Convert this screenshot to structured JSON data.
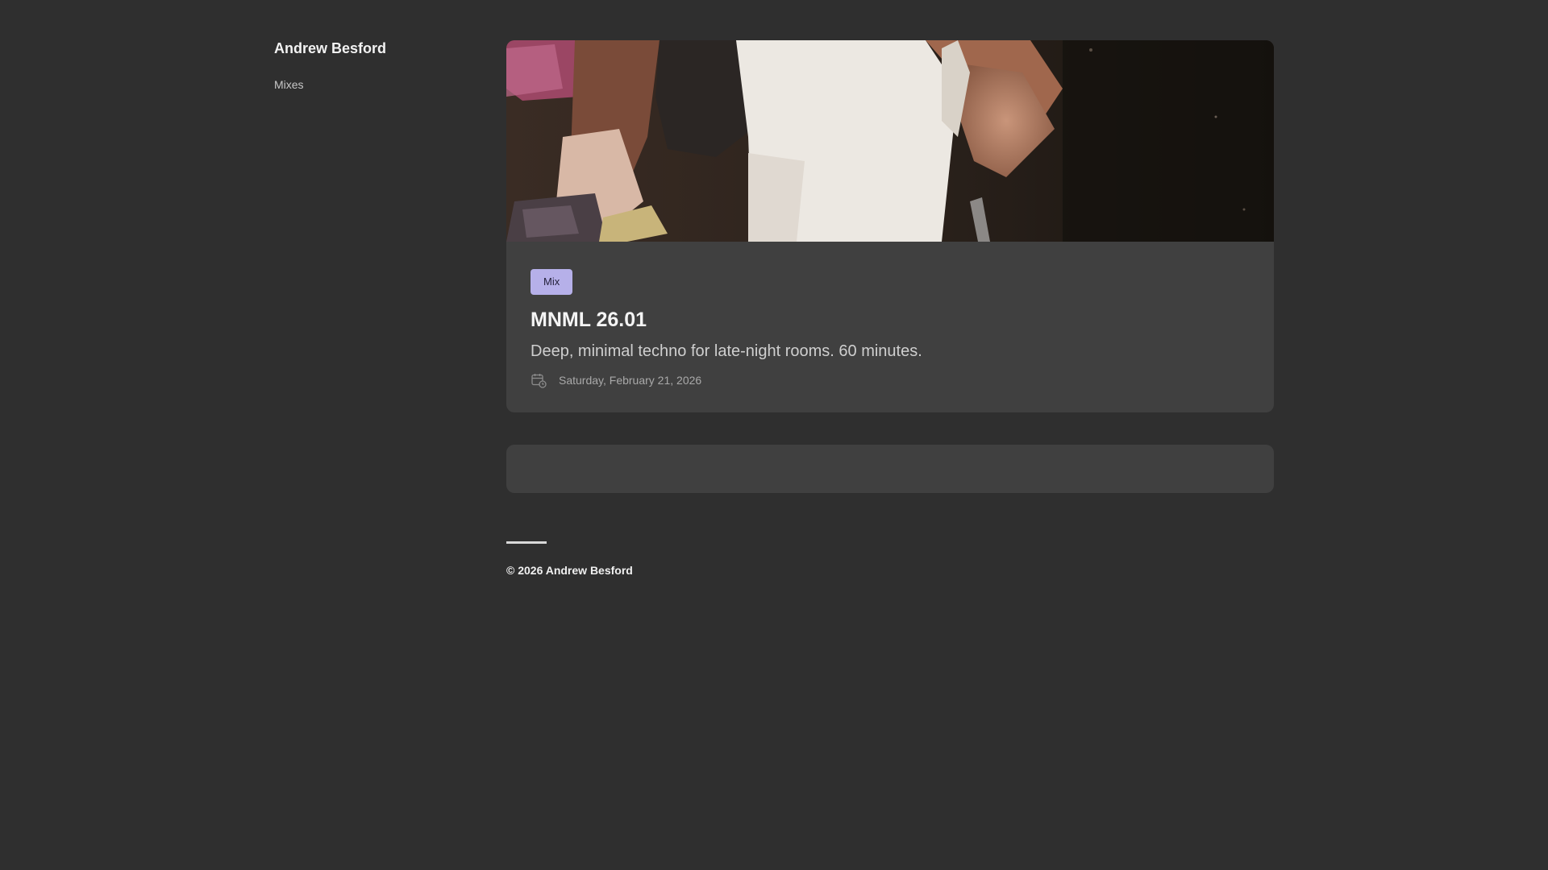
{
  "site": {
    "title": "Andrew Besford",
    "nav": [
      {
        "label": "Mixes"
      }
    ]
  },
  "post": {
    "tag": "Mix",
    "title": "MNML 26.01",
    "description": "Deep, minimal techno for late-night rooms. 60 minutes.",
    "date": "Saturday, February 21, 2026",
    "date_icon": "calendar-clock-icon"
  },
  "footer": {
    "copyright": "© 2026 Andrew Besford"
  },
  "colors": {
    "background": "#2f2f2f",
    "card": "#404040",
    "tag": "#b6b0e9",
    "text": "#e8e8e8"
  }
}
